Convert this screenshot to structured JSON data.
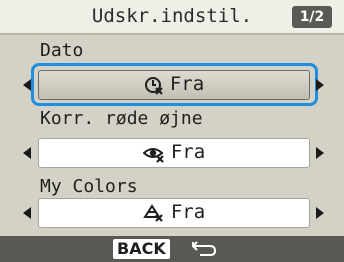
{
  "header": {
    "title": "Udskr.indstil.",
    "page_indicator": "1/2"
  },
  "settings": [
    {
      "label": "Dato",
      "value": "Fra",
      "icon": "date-off-icon",
      "selected": true
    },
    {
      "label": "Korr. røde øjne",
      "value": "Fra",
      "icon": "red-eye-off-icon",
      "selected": false
    },
    {
      "label": "My Colors",
      "value": "Fra",
      "icon": "my-colors-off-icon",
      "selected": false
    }
  ],
  "footer": {
    "back_label": "BACK",
    "back_icon": "return-arrow-icon"
  },
  "colors": {
    "focus": "#1e8fe0",
    "background": "#d4d2c7",
    "footer": "#5a5852",
    "badge": "#5b5954"
  }
}
